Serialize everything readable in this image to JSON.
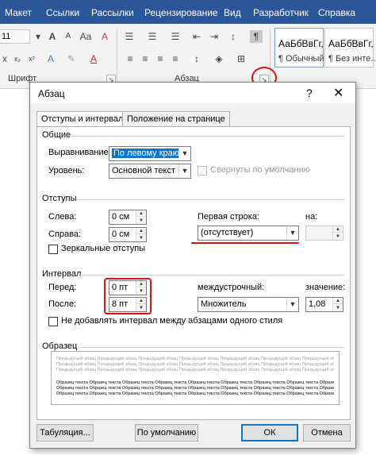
{
  "ribbon": {
    "tabs": [
      "Макет",
      "Ссылки",
      "Рассылки",
      "Рецензирование",
      "Вид",
      "Разработчик",
      "Справка"
    ],
    "font_size_value": "11",
    "font_group_label": "Шрифт",
    "paragraph_group_label": "Абзац",
    "styles": [
      {
        "sample": "АаБбВвГг,",
        "name": "¶ Обычный"
      },
      {
        "sample": "АаБбВвГг,",
        "name": "¶ Без инте..."
      }
    ]
  },
  "dialog": {
    "title": "Абзац",
    "help": "?",
    "close": "✕",
    "tabs": [
      "Отступы и интервалы",
      "Положение на странице"
    ],
    "general": {
      "section": "Общие",
      "alignment_label": "Выравнивание:",
      "alignment_value": "По левому краю",
      "level_label": "Уровень:",
      "level_value": "Основной текст",
      "collapsed_label": "Свернуты по умолчанию"
    },
    "indents": {
      "section": "Отступы",
      "left_label": "Слева:",
      "left_value": "0 см",
      "right_label": "Справа:",
      "right_value": "0 см",
      "first_line_label": "Первая строка:",
      "first_line_value": "(отсутствует)",
      "by_label": "на:",
      "by_value": "",
      "mirror_label": "Зеркальные отступы"
    },
    "spacing": {
      "section": "Интервал",
      "before_label": "Перед:",
      "before_value": "0 пт",
      "after_label": "После:",
      "after_value": "8 пт",
      "line_spacing_label": "междустрочный:",
      "line_spacing_value": "Множитель",
      "value_label": "значение:",
      "value_value": "1,08",
      "no_space_label": "Не добавлять интервал между абзацами одного стиля"
    },
    "preview": {
      "section": "Образец",
      "prev_text": "Предыдущий абзац Предыдущий абзац Предыдущий абзац Предыдущий абзац Предыдущий абзац Предыдущий абзац Предыдущий абзац Предыдущий абзац",
      "sample_text": "Образец текста Образец текста Образец текста Образец текста Образец текста Образец текста Образец текста Образец текста Образец текста"
    },
    "buttons": {
      "tabs": "Табуляция...",
      "default": "По умолчанию",
      "ok": "ОК",
      "cancel": "Отмена"
    }
  },
  "colors": {
    "ribbon_blue": "#2b579a",
    "accent": "#0078d7",
    "annotation_red": "#e01010"
  }
}
